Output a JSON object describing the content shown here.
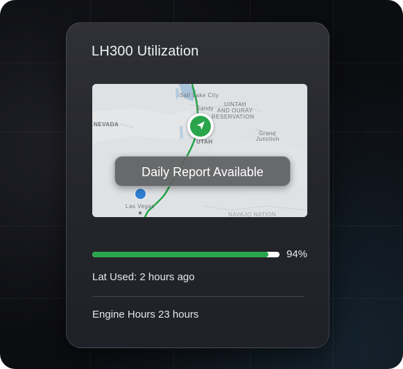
{
  "card": {
    "title": "LH300 Utilization"
  },
  "map": {
    "labels": {
      "salt_lake_city": "Salt Lake City",
      "sandy": "Sandy",
      "uintah_line1": "UINTAH",
      "uintah_line2": "AND OURAY",
      "uintah_line3": "RESERVATION",
      "nevada": "NEVADA",
      "utah": "UTAH",
      "grand_junction_line1": "Grand",
      "grand_junction_line2": "Junction",
      "las_vegas": "Las Vegas",
      "navajo_nation": "NAVAJO NATION"
    },
    "overlay_label": "Daily Report Available",
    "marker_icon": "navigation-arrow-icon",
    "route_color": "#2aa54b",
    "location_color": "#2f7fd1"
  },
  "utilization": {
    "percent": 94,
    "percent_label": "94%",
    "bar_color": "#2aa54b"
  },
  "last_used": "Lat Used: 2 hours ago",
  "engine_hours": "Engine Hours 23 hours"
}
